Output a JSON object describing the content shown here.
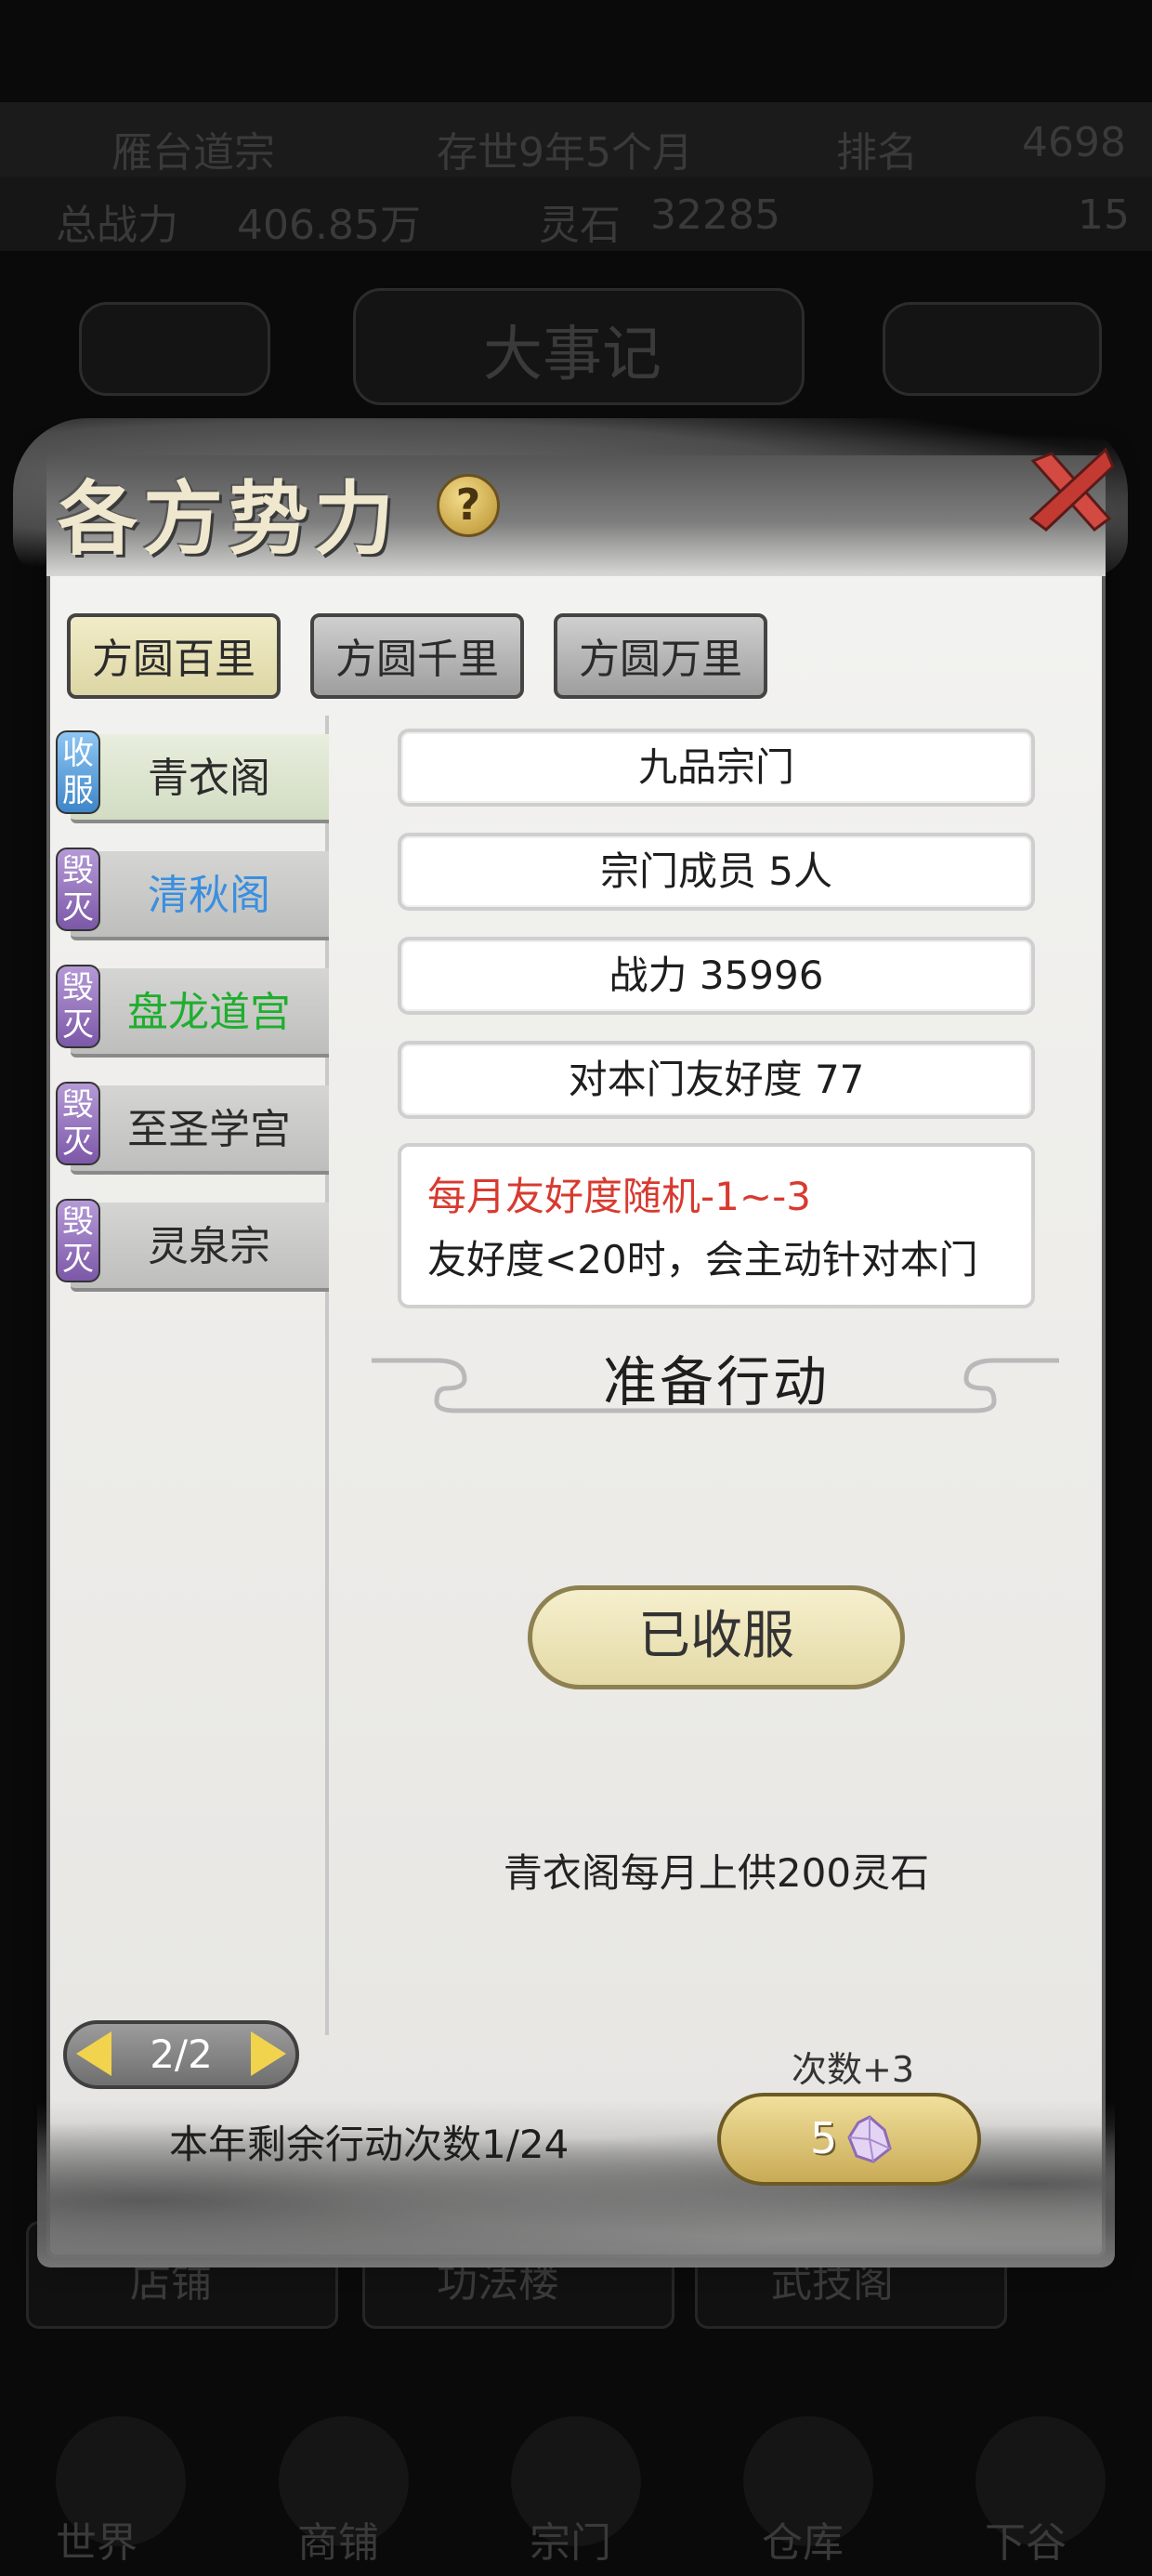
{
  "background": {
    "top_bar": [
      "雁台道宗",
      "存世9年5个月",
      "排名",
      "4698"
    ],
    "stat_bar": [
      "总战力",
      "406.85万",
      "灵石",
      "32285",
      "15"
    ],
    "center_title": "大事记",
    "bottom_tiles": [
      "店铺",
      "功法楼",
      "武技阁"
    ],
    "nav_labels": [
      "世界",
      "商铺",
      "宗门",
      "仓库",
      "下谷"
    ]
  },
  "modal": {
    "title": "各方势力",
    "tabs": [
      "方圆百里",
      "方圆千里",
      "方圆万里"
    ],
    "active_tab_index": 0
  },
  "sidebar": {
    "items": [
      {
        "badge": "收服",
        "badge_color": "blue",
        "label": "青衣阁",
        "label_color": "#2b2b2b",
        "selected": true
      },
      {
        "badge": "毁灭",
        "badge_color": "purple",
        "label": "清秋阁",
        "label_color": "#3a8fe0",
        "selected": false
      },
      {
        "badge": "毁灭",
        "badge_color": "purple",
        "label": "盘龙道宫",
        "label_color": "#1fae2e",
        "selected": false
      },
      {
        "badge": "毁灭",
        "badge_color": "purple",
        "label": "至圣学宫",
        "label_color": "#2b2b2b",
        "selected": false
      },
      {
        "badge": "毁灭",
        "badge_color": "purple",
        "label": "灵泉宗",
        "label_color": "#2b2b2b",
        "selected": false
      }
    ]
  },
  "details": {
    "rank": "九品宗门",
    "members": "宗门成员 5人",
    "power": "战力 35996",
    "friendship": "对本门友好度 77",
    "note_red": "每月友好度随机-1~-3",
    "note_black": "友好度<20时，会主动针对本门"
  },
  "action": {
    "section_title": "准备行动",
    "button_label": "已收服",
    "tribute_text": "青衣阁每月上供200灵石"
  },
  "footer": {
    "page": "2/2",
    "remaining_actions": "本年剩余行动次数1/24",
    "count_plus_label": "次数+3",
    "cost_value": "5"
  },
  "colors": {
    "accent_gold": "#f1d34e",
    "warning_red": "#d83a2f"
  },
  "icons": [
    "help-icon",
    "close-icon",
    "arrow-left-icon",
    "arrow-right-icon",
    "spirit-gem-icon"
  ]
}
